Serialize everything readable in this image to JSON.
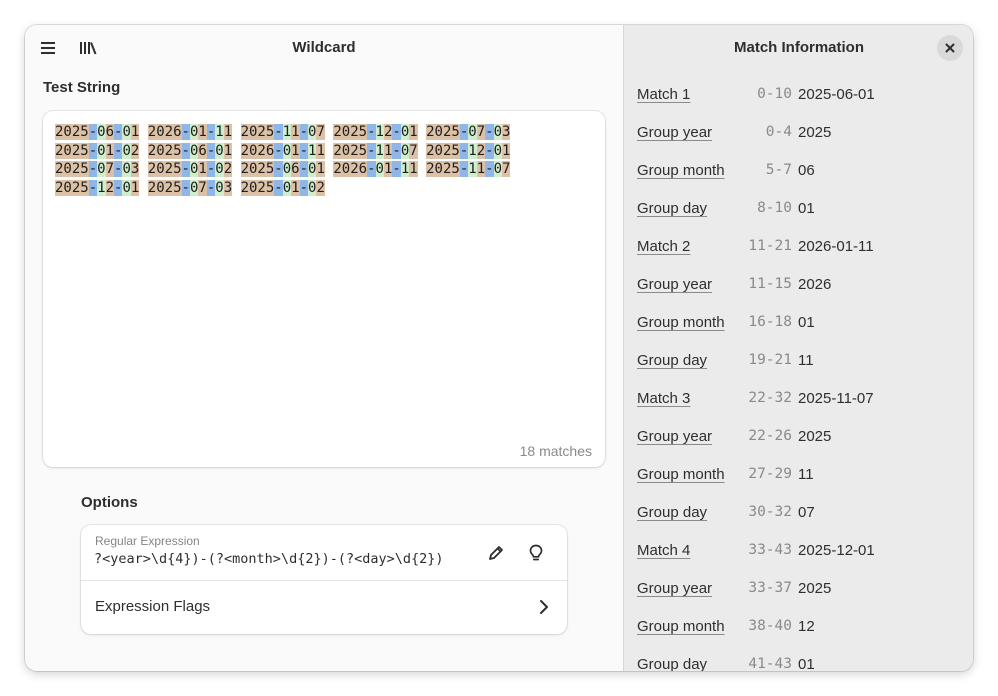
{
  "header": {
    "title": "Wildcard",
    "menu_icon": "hamburger-menu-icon",
    "library_icon": "library-icon"
  },
  "test_string": {
    "title": "Test String",
    "lines": [
      [
        "2025-06-01",
        "2026-01-11",
        "2025-11-07",
        "2025-12-01",
        "2025-07-03"
      ],
      [
        "2025-01-02",
        "2025-06-01",
        "2026-01-11",
        "2025-11-07",
        "2025-12-01"
      ],
      [
        "2025-07-03",
        "2025-01-02",
        "2025-06-01",
        "2026-01-11",
        "2025-11-07"
      ],
      [
        "2025-12-01",
        "2025-07-03",
        "2025-01-02"
      ]
    ],
    "match_count": "18 matches"
  },
  "options": {
    "title": "Options",
    "regex_label": "Regular Expression",
    "regex_value": "?<year>\\d{4})-(?<month>\\d{2})-(?<day>\\d{2})",
    "edit_icon": "pencil-icon",
    "hint_icon": "lightbulb-icon",
    "flags_label": "Expression Flags",
    "flags_icon": "chevron-right-icon"
  },
  "match_panel": {
    "title": "Match Information",
    "close_icon": "close-icon",
    "rows": [
      {
        "name": "Match 1",
        "range": "0-10",
        "value": "2025-06-01"
      },
      {
        "name": "Group year",
        "range": "0-4",
        "value": "2025"
      },
      {
        "name": "Group month",
        "range": "5-7",
        "value": "06"
      },
      {
        "name": "Group day",
        "range": "8-10",
        "value": "01"
      },
      {
        "name": "Match 2",
        "range": "11-21",
        "value": "2026-01-11"
      },
      {
        "name": "Group year",
        "range": "11-15",
        "value": "2026"
      },
      {
        "name": "Group month",
        "range": "16-18",
        "value": "01"
      },
      {
        "name": "Group day",
        "range": "19-21",
        "value": "11"
      },
      {
        "name": "Match 3",
        "range": "22-32",
        "value": "2025-11-07"
      },
      {
        "name": "Group year",
        "range": "22-26",
        "value": "2025"
      },
      {
        "name": "Group month",
        "range": "27-29",
        "value": "11"
      },
      {
        "name": "Group day",
        "range": "30-32",
        "value": "07"
      },
      {
        "name": "Match 4",
        "range": "33-43",
        "value": "2025-12-01"
      },
      {
        "name": "Group year",
        "range": "33-37",
        "value": "2025"
      },
      {
        "name": "Group month",
        "range": "38-40",
        "value": "12"
      },
      {
        "name": "Group day",
        "range": "41-43",
        "value": "01"
      }
    ]
  }
}
